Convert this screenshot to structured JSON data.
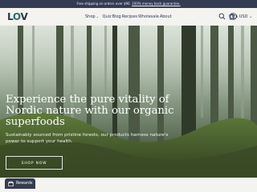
{
  "announcement": {
    "text": "Free shipping on orders over $90. ",
    "guarantee": "100% money back guarantee."
  },
  "header": {
    "logo": {
      "pre": "L",
      "leaf": "O",
      "post": "V"
    },
    "nav": [
      {
        "label": "Shop",
        "has_dropdown": true,
        "caret": "⌄"
      },
      {
        "label": "Quiz"
      },
      {
        "label": "Blog"
      },
      {
        "label": "Recipes"
      },
      {
        "label": "Wholesale"
      },
      {
        "label": "About"
      }
    ],
    "icons": [
      "search-icon",
      "account-icon",
      "cart-icon"
    ],
    "currency": "$ USD",
    "currency_caret": "⌄"
  },
  "hero": {
    "headline": "Experience the pure vitality of Nordic nature with our organic superfoods",
    "subheadline": "Sustainably sourced from pristine forests, our products harness nature's power to support your health.",
    "cta": "SHOP NOW"
  },
  "rewards": {
    "label": "Rewards"
  },
  "colors": {
    "brand_navy": "#333c52",
    "logo_teal": "#2c6b6a",
    "header_bg": "#f3f3ef"
  }
}
